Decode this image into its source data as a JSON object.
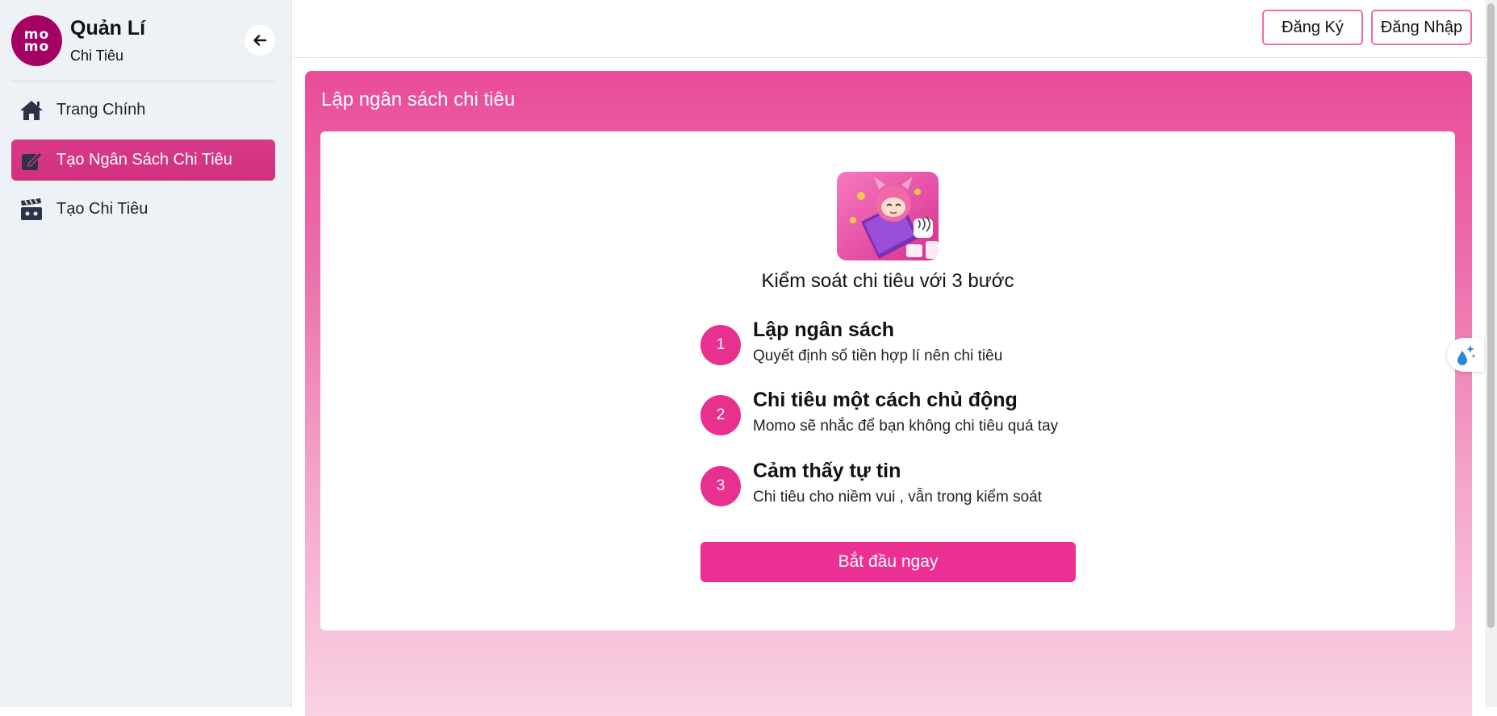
{
  "sidebar": {
    "logo_line1": "mo",
    "logo_line2": "mo",
    "brand_title": "Quản Lí",
    "brand_subtitle": "Chi Tiêu",
    "items": [
      {
        "label": "Trang Chính",
        "icon": "home-icon",
        "active": false
      },
      {
        "label": "Tạo Ngân Sách Chi Tiêu",
        "icon": "edit-note-icon",
        "active": true
      },
      {
        "label": "Tạo Chi Tiêu",
        "icon": "clapperboard-icon",
        "active": false
      }
    ]
  },
  "header": {
    "register_label": "Đăng Ký",
    "login_label": "Đăng Nhập"
  },
  "panel": {
    "title": "Lập ngân sách chi tiêu",
    "heading": "Kiểm soát chi tiêu với 3 bước",
    "steps": [
      {
        "number": "1",
        "title": "Lập ngân sách",
        "description": "Quyết định số tiền hợp lí nên chi tiêu"
      },
      {
        "number": "2",
        "title": "Chi tiêu một cách chủ động",
        "description": "Momo sẽ nhắc để bạn không chi tiêu quá tay"
      },
      {
        "number": "3",
        "title": "Cảm thấy tự tin",
        "description": "Chi tiêu cho niềm vui , vẫn trong kiểm soát"
      }
    ],
    "start_label": "Bắt đầu ngay"
  },
  "colors": {
    "brand": "#a50064",
    "accent": "#ec2f92",
    "active_nav": "#d63384"
  }
}
